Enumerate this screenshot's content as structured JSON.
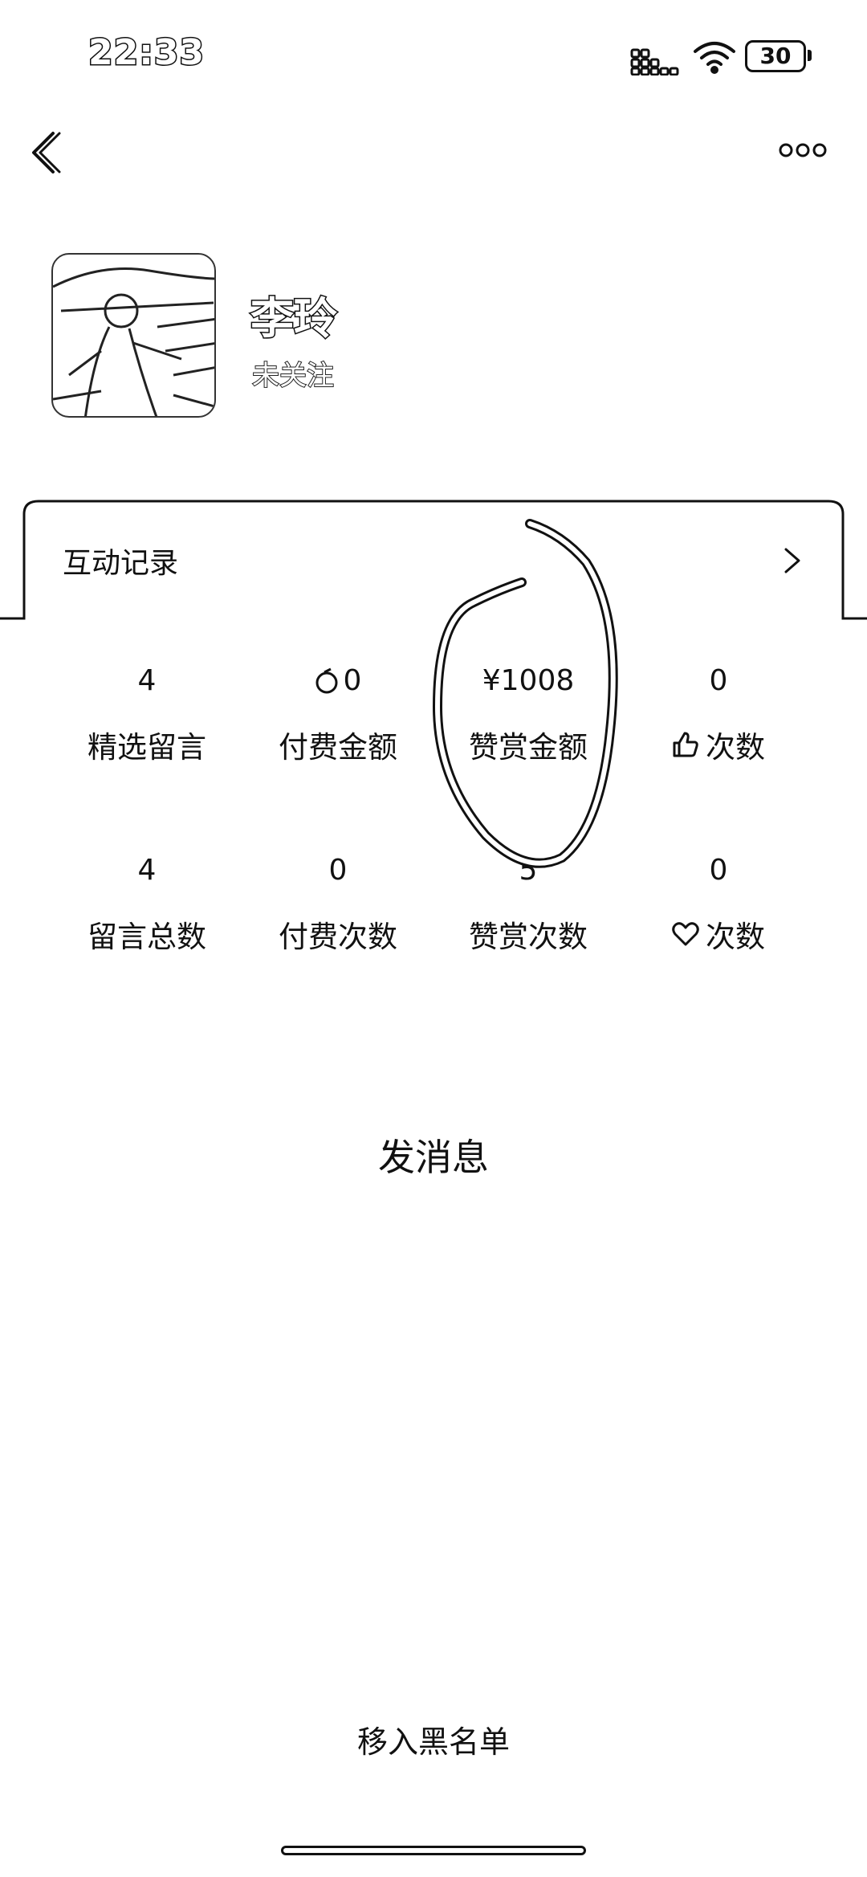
{
  "status_bar": {
    "time": "22:33",
    "battery": "30",
    "icons": [
      "signal-icon",
      "wifi-icon",
      "battery-icon"
    ]
  },
  "nav": {
    "back_icon": "chevron-left-icon",
    "more_icon": "more-icon"
  },
  "profile": {
    "name": "李玲",
    "follow_status": "未关注"
  },
  "card": {
    "title": "互动记录",
    "arrow_icon": "chevron-right-icon",
    "stats": [
      {
        "value": "4",
        "label": "精选留言"
      },
      {
        "value": "0",
        "label": "付费金额",
        "value_icon": "coin-icon"
      },
      {
        "value": "¥1008",
        "label": "赞赏金额"
      },
      {
        "value": "0",
        "label": "次数",
        "label_icon": "thumb-up-icon"
      },
      {
        "value": "4",
        "label": "留言总数"
      },
      {
        "value": "0",
        "label": "付费次数"
      },
      {
        "value": "5",
        "label": "赞赏次数"
      },
      {
        "value": "0",
        "label": "次数",
        "label_icon": "heart-icon"
      }
    ]
  },
  "actions": {
    "send_message": "发消息",
    "block": "移入黑名单"
  }
}
